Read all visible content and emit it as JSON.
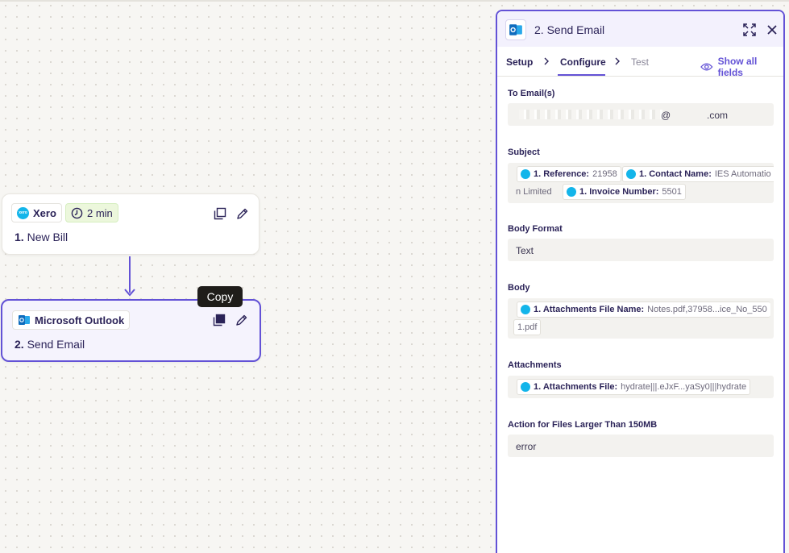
{
  "canvas": {
    "nodes": [
      {
        "app": "Xero",
        "duration": "2 min",
        "step_number": "1.",
        "step_title": "New Bill"
      },
      {
        "app": "Microsoft Outlook",
        "step_number": "2.",
        "step_title": "Send Email"
      }
    ],
    "tooltip": "Copy"
  },
  "panel": {
    "title": "2. Send Email",
    "tabs": [
      "Setup",
      "Configure",
      "Test"
    ],
    "active_tab": "Configure",
    "show_all_fields": "Show all fields",
    "fields": {
      "to_email": {
        "label": "To Email(s)",
        "value_at": "@",
        "value_domain": ".com"
      },
      "subject": {
        "label": "Subject",
        "tokens": [
          {
            "name": "1. Reference:",
            "value": "21958"
          },
          {
            "name": "1. Contact Name:",
            "value": "IES Automatio"
          },
          {
            "name": "1. Invoice Number:",
            "value": "5501"
          }
        ],
        "wrap_text": "n Limited"
      },
      "body_format": {
        "label": "Body Format",
        "value": "Text"
      },
      "body": {
        "label": "Body",
        "token_name": "1. Attachments File Name:",
        "token_value": "Notes.pdf,37958...ice_No_550",
        "wrap_text": "1.pdf"
      },
      "attachments": {
        "label": "Attachments",
        "token_name": "1. Attachments File:",
        "token_value": "hydrate|||.eJxF...yaSy0|||hydrate"
      },
      "large_files": {
        "label": "Action for Files Larger Than 150MB",
        "value": "error"
      }
    }
  },
  "colors": {
    "accent": "#6352d6",
    "xero": "#13b5ea",
    "outlook": "#0f6cbd"
  },
  "icons": [
    "xero-icon",
    "clock-icon",
    "outlook-icon",
    "duplicate-icon",
    "edit-icon",
    "expand-icon",
    "close-icon",
    "eye-icon",
    "chevron-right-icon"
  ]
}
